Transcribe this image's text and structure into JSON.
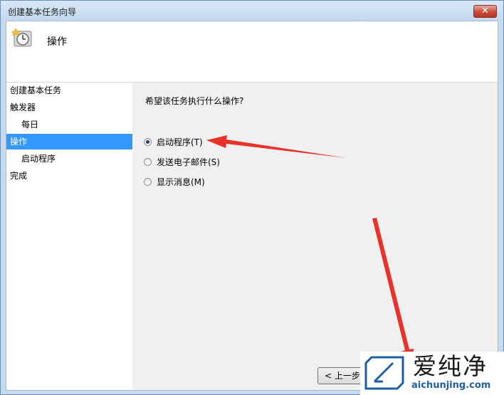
{
  "window": {
    "title": "创建基本任务向导",
    "close_label": "✕"
  },
  "header": {
    "title": "操作",
    "icon": "task-clock-icon"
  },
  "steps": [
    {
      "label": "创建基本任务",
      "level": 0,
      "active": false
    },
    {
      "label": "触发器",
      "level": 0,
      "active": false
    },
    {
      "label": "每日",
      "level": 1,
      "active": false
    },
    {
      "label": "操作",
      "level": 0,
      "active": true
    },
    {
      "label": "启动程序",
      "level": 1,
      "active": false
    },
    {
      "label": "完成",
      "level": 0,
      "active": false
    }
  ],
  "main": {
    "question": "希望该任务执行什么操作?",
    "options": [
      {
        "label": "启动程序(T)",
        "checked": true
      },
      {
        "label": "发送电子邮件(S)",
        "checked": false
      },
      {
        "label": "显示消息(M)",
        "checked": false
      }
    ]
  },
  "footer": {
    "prev_label": "< 上一步(B)"
  },
  "annotation": {
    "arrow_color": "#e8322b"
  },
  "watermark": {
    "name": "爱纯净",
    "url": "aichunjing.com",
    "logo_color": "#1e5fa8"
  }
}
